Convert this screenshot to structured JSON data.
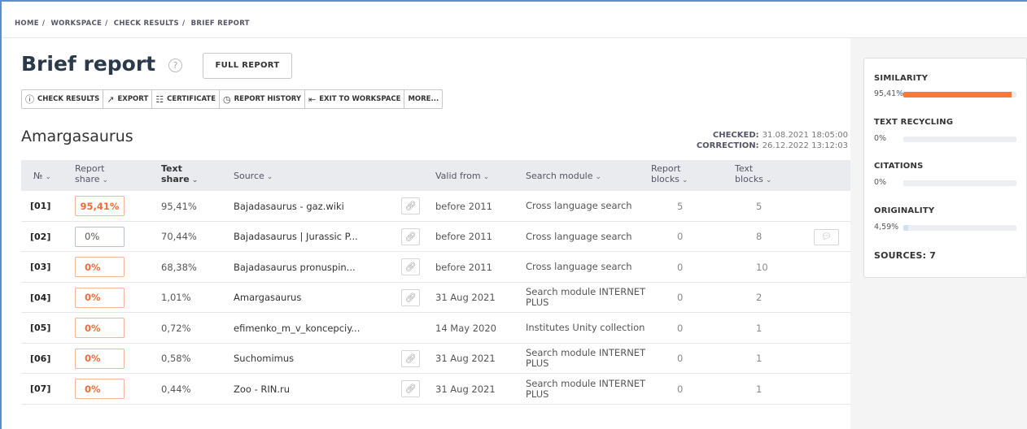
{
  "breadcrumb": [
    "HOME",
    "WORKSPACE",
    "CHECK RESULTS",
    "BRIEF REPORT"
  ],
  "header": {
    "title": "Brief report",
    "help_glyph": "?",
    "full_report_label": "FULL REPORT"
  },
  "toolbar": [
    {
      "icon": "info-icon",
      "glyph": "ⓘ",
      "label": "CHECK RESULTS"
    },
    {
      "icon": "export-icon",
      "glyph": "↗",
      "label": "EXPORT"
    },
    {
      "icon": "certificate-icon",
      "glyph": "☷",
      "label": "CERTIFICATE"
    },
    {
      "icon": "history-icon",
      "glyph": "◷",
      "label": "REPORT HISTORY"
    },
    {
      "icon": "exit-icon",
      "glyph": "⇤",
      "label": "EXIT TO WORKSPACE"
    },
    {
      "icon": "",
      "glyph": "",
      "label": "MORE..."
    }
  ],
  "document": {
    "name": "Amargasaurus",
    "checked_label": "CHECKED:",
    "checked_value": "31.08.2021 18:05:00",
    "correction_label": "CORRECTION:",
    "correction_value": "26.12.2022 13:12:03"
  },
  "table": {
    "headers": {
      "num": "№",
      "report_share_1": "Report",
      "report_share_2": "share",
      "text_share_1": "Text",
      "text_share_2": "share",
      "source": "Source",
      "valid_from": "Valid from",
      "module": "Search module",
      "report_blocks_1": "Report",
      "report_blocks_2": "blocks",
      "text_blocks_1": "Text",
      "text_blocks_2": "blocks"
    },
    "rows": [
      {
        "num": "[01]",
        "report_share": "95,41%",
        "text_share": "95,41%",
        "source": "Bajadasaurus - gaz.wiki",
        "link": true,
        "valid_from": "before 2011",
        "module": "Cross language search",
        "report_blocks": "5",
        "text_blocks": "5",
        "comment": false,
        "style": "orange"
      },
      {
        "num": "[02]",
        "report_share": "0%",
        "text_share": "70,44%",
        "source": "Bajadasaurus | Jurassic P...",
        "link": true,
        "valid_from": "before 2011",
        "module": "Cross language search",
        "report_blocks": "0",
        "text_blocks": "8",
        "comment": true,
        "style": "gray"
      },
      {
        "num": "[03]",
        "report_share": "0%",
        "text_share": "68,38%",
        "source": "Bajadasaurus pronuspin...",
        "link": true,
        "valid_from": "before 2011",
        "module": "Cross language search",
        "report_blocks": "0",
        "text_blocks": "10",
        "comment": false,
        "style": "orange-left"
      },
      {
        "num": "[04]",
        "report_share": "0%",
        "text_share": "1,01%",
        "source": "Amargasaurus",
        "link": true,
        "valid_from": "31 Aug 2021",
        "module": "Search module INTERNET PLUS",
        "report_blocks": "0",
        "text_blocks": "2",
        "comment": false,
        "style": "orange-left"
      },
      {
        "num": "[05]",
        "report_share": "0%",
        "text_share": "0,72%",
        "source": "efimenko_m_v_koncepciy...",
        "link": false,
        "valid_from": "14 May 2020",
        "module": "Institutes Unity collection",
        "report_blocks": "0",
        "text_blocks": "1",
        "comment": false,
        "style": "orange-left"
      },
      {
        "num": "[06]",
        "report_share": "0%",
        "text_share": "0,58%",
        "source": "Suchomimus",
        "link": true,
        "valid_from": "31 Aug 2021",
        "module": "Search module INTERNET PLUS",
        "report_blocks": "0",
        "text_blocks": "1",
        "comment": false,
        "style": "orange-left"
      },
      {
        "num": "[07]",
        "report_share": "0%",
        "text_share": "0,44%",
        "source": "Zoo - RIN.ru",
        "link": true,
        "valid_from": "31 Aug 2021",
        "module": "Search module INTERNET PLUS",
        "report_blocks": "0",
        "text_blocks": "1",
        "comment": false,
        "style": "orange-left"
      }
    ]
  },
  "summary": {
    "similarity_label": "SIMILARITY",
    "similarity_value": "95,41%",
    "similarity_fraction": 0.9541,
    "recycling_label": "TEXT RECYCLING",
    "recycling_value": "0%",
    "recycling_fraction": 0,
    "citations_label": "CITATIONS",
    "citations_value": "0%",
    "citations_fraction": 0,
    "originality_label": "ORIGINALITY",
    "originality_value": "4,59%",
    "originality_fraction": 0.0459,
    "sources_label": "SOURCES: 7"
  },
  "colors": {
    "accent": "#f47a3e",
    "frame": "#5b8fc7",
    "header_bg": "#e9ebee"
  }
}
